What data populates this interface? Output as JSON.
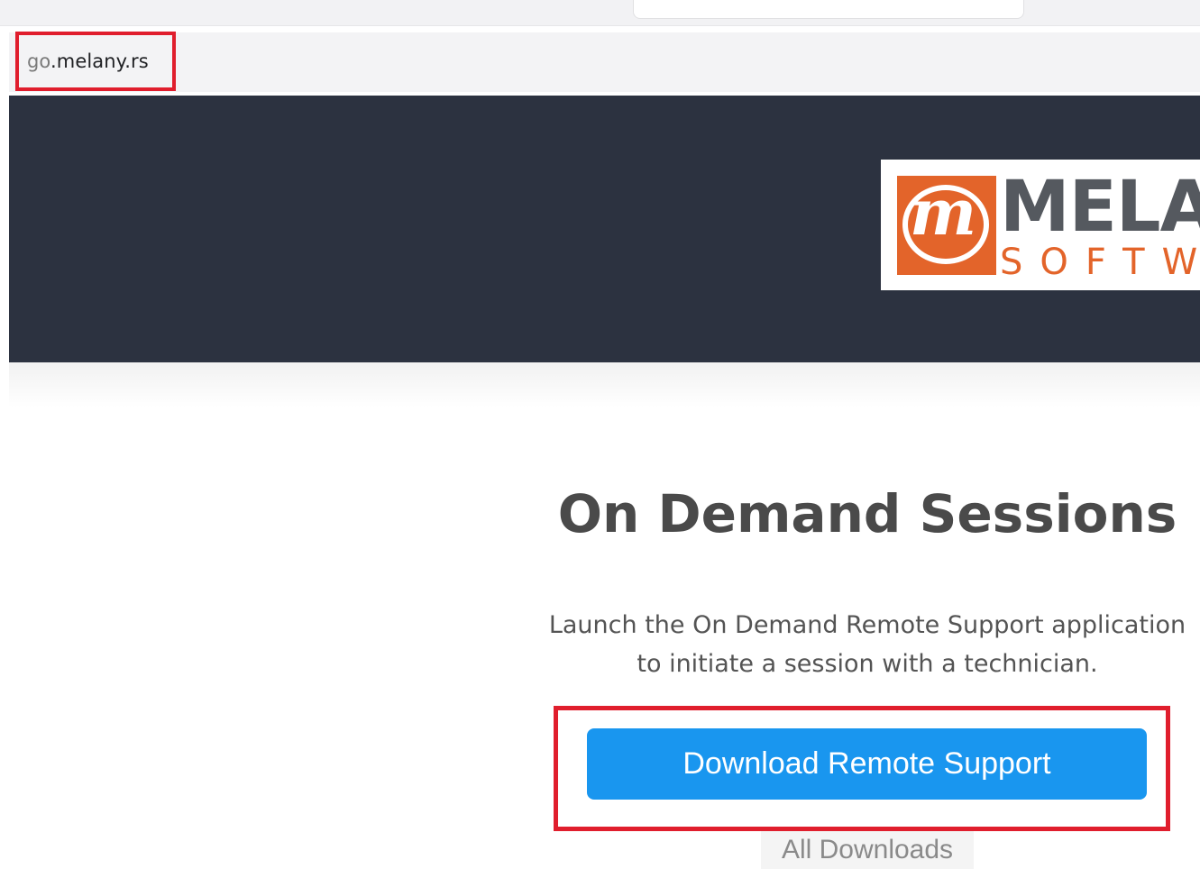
{
  "browser": {
    "url_subdomain": "go",
    "url_domain": ".melany.rs"
  },
  "header": {
    "logo": {
      "letter": "m",
      "word": "MELA",
      "sub": "SOFTW",
      "brand_color": "#e3642a",
      "background_color": "#2c3240"
    }
  },
  "main": {
    "title": "On Demand Sessions",
    "description_line1": "Launch the On Demand Remote Support application",
    "description_line2": "to initiate a session with a technician.",
    "download_button_label": "Download Remote Support",
    "download_button_color": "#1996ef",
    "all_downloads_label": "All Downloads"
  },
  "annotations": {
    "highlight_color": "#e01e2d"
  }
}
